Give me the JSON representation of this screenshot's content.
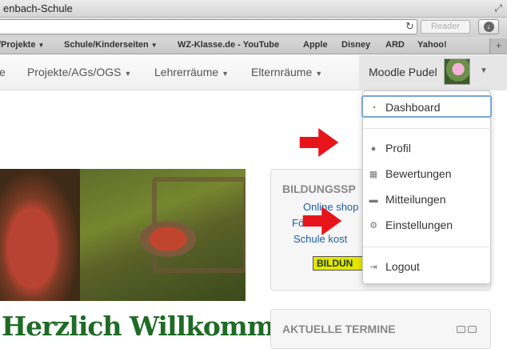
{
  "window": {
    "title": "enbach-Schule"
  },
  "toolbar": {
    "reader_label": "Reader",
    "reload_icon": "reload-icon",
    "download_icon": "download-icon"
  },
  "bookmarks": [
    {
      "label": "/Projekte",
      "has_menu": true
    },
    {
      "label": "Schule/Kinderseiten",
      "has_menu": true
    },
    {
      "label": "WZ-Klasse.de - YouTube",
      "has_menu": false
    },
    {
      "label": "Apple",
      "has_menu": false
    },
    {
      "label": "Disney",
      "has_menu": false
    },
    {
      "label": "ARD",
      "has_menu": false
    },
    {
      "label": "Yahoo!",
      "has_menu": false
    }
  ],
  "nav": {
    "items": [
      {
        "label": "e"
      },
      {
        "label": "Projekte/AGs/OGS"
      },
      {
        "label": "Lehrerräume"
      },
      {
        "label": "Elternräume"
      }
    ],
    "user_name": "Moodle Pudel"
  },
  "user_dropdown": {
    "items": [
      {
        "label": "Dashboard",
        "icon": "dashboard-icon",
        "active": true
      },
      {
        "label": "Profil",
        "icon": "user-icon"
      },
      {
        "label": "Bewertungen",
        "icon": "table-icon"
      },
      {
        "label": "Mitteilungen",
        "icon": "speech-bubble-icon"
      },
      {
        "label": "Einstellungen",
        "icon": "gear-icon"
      },
      {
        "label": "Logout",
        "icon": "logout-icon"
      }
    ]
  },
  "main": {
    "welcome": "Herzlich Willkommen"
  },
  "sidebar": {
    "bildung_block": {
      "title": "BILDUNGSSP",
      "links": [
        "Online shop",
        "Förde",
        "Schule kost"
      ],
      "badge": "BILDUN"
    },
    "termine_block": {
      "title": "AKTUELLE TERMINE"
    }
  },
  "annotations": {
    "arrow_color": "#e8141b"
  },
  "colors": {
    "accent": "#1b5fa8",
    "welcome_green": "#1e6b26",
    "focus_outline": "#7aa6d8"
  }
}
